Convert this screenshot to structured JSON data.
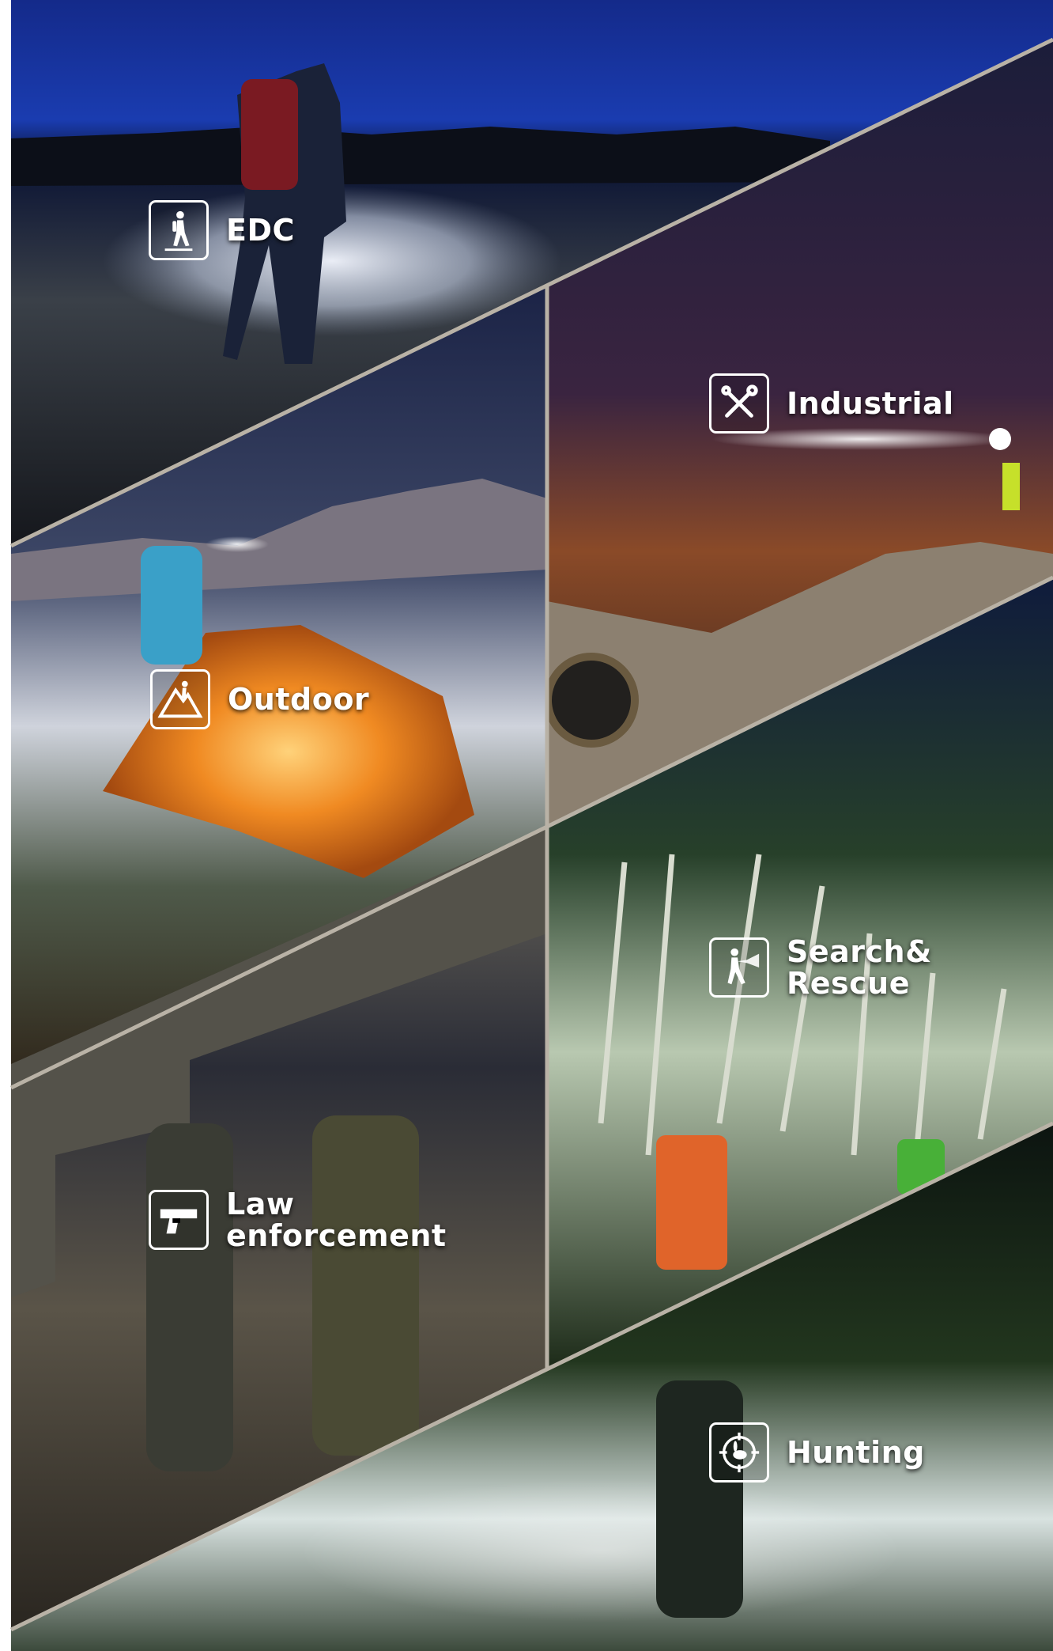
{
  "categories": [
    {
      "id": "edc",
      "label": "EDC",
      "icon": "hiker-icon"
    },
    {
      "id": "industrial",
      "label": "Industrial",
      "icon": "tools-icon"
    },
    {
      "id": "outdoor",
      "label": "Outdoor",
      "icon": "mountain-climber-icon"
    },
    {
      "id": "search-rescue",
      "label": "Search&\nRescue",
      "icon": "rescuer-flashlight-icon"
    },
    {
      "id": "law-enforcement",
      "label": "Law\nenforcement",
      "icon": "pistol-icon"
    },
    {
      "id": "hunting",
      "label": "Hunting",
      "icon": "crosshair-rabbit-icon"
    }
  ],
  "colors": {
    "divider": "#b9b2a6",
    "label_text": "#ffffff",
    "left_margin": "#ffffff"
  }
}
